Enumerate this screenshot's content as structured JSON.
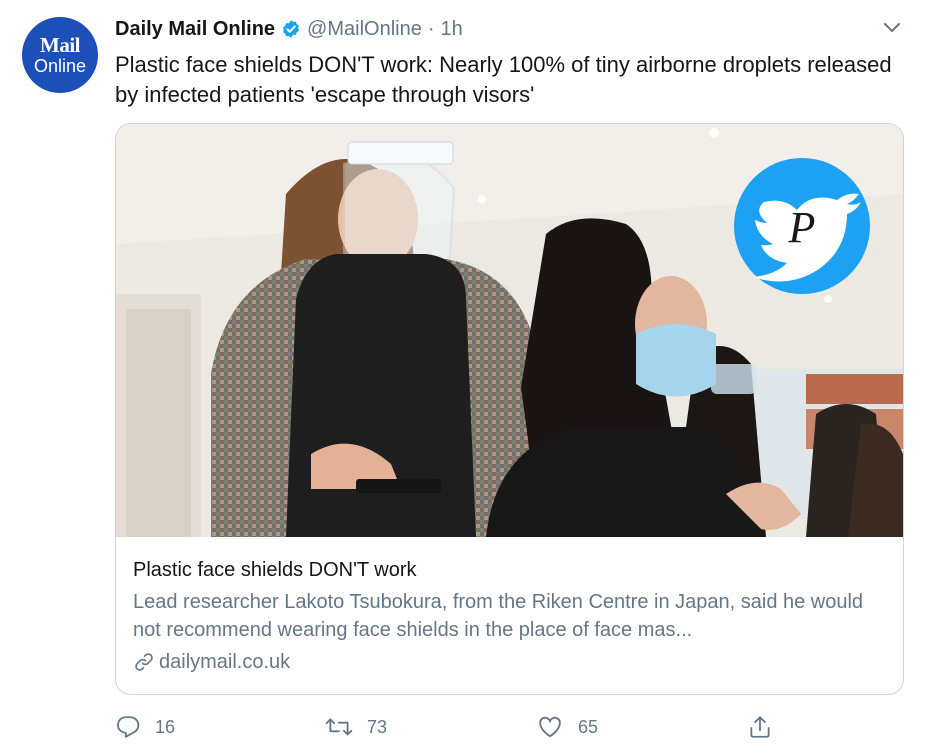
{
  "author": {
    "avatar_line1": "Mail",
    "avatar_line2": "Online",
    "name": "Daily Mail Online",
    "handle": "@MailOnline",
    "separator": "·",
    "time": "1h"
  },
  "tweet": {
    "text": "Plastic face shields DON'T work: Nearly 100% of tiny airborne droplets released by infected patients 'escape through visors'"
  },
  "card": {
    "title": "Plastic face shields DON'T work",
    "description": "Lead researcher Lakoto Tsubokura, from the Riken Centre in Japan, said he would not recommend wearing face shields in the place of face mas...",
    "domain": "dailymail.co.uk"
  },
  "actions": {
    "replies": "16",
    "retweets": "73",
    "likes": "65"
  },
  "colors": {
    "text": "#14171a",
    "secondary": "#657786",
    "border": "#ccd6dd",
    "verified": "#1da1f2",
    "avatar_bg": "#1d4fb8"
  },
  "icons": {
    "verified": "verified-badge-icon",
    "caret": "chevron-down-icon",
    "link": "link-icon",
    "reply": "reply-icon",
    "retweet": "retweet-icon",
    "like": "heart-icon",
    "share": "share-icon",
    "watermark": "twitter-bird-watermark"
  }
}
